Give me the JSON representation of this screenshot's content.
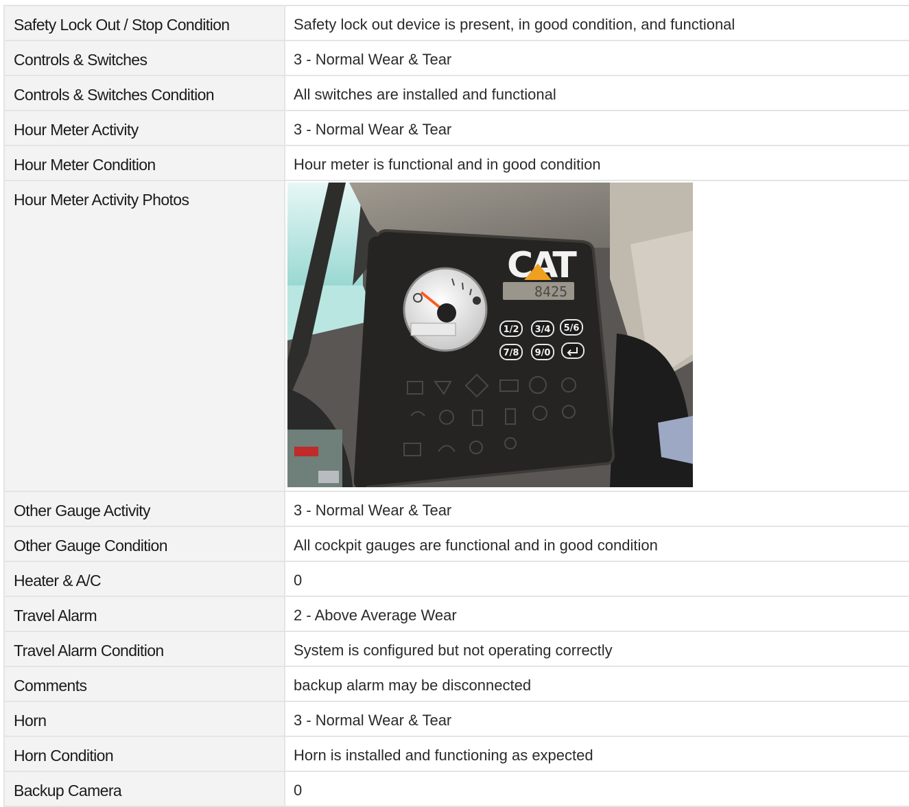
{
  "rows": [
    {
      "label": "Safety Lock Out / Stop Condition",
      "value": "Safety lock out device is present, in good condition, and functional"
    },
    {
      "label": "Controls & Switches",
      "value": "3 - Normal Wear & Tear"
    },
    {
      "label": "Controls & Switches Condition",
      "value": "All switches are installed and functional"
    },
    {
      "label": "Hour Meter Activity",
      "value": "3 - Normal Wear & Tear"
    },
    {
      "label": "Hour Meter Condition",
      "value": "Hour meter is functional and in good condition"
    }
  ],
  "photo_row": {
    "label": "Hour Meter Activity Photos",
    "photo": {
      "brand_text": "CAT",
      "hour_reading": "8425",
      "keypad_keys": [
        "1/2",
        "3/4",
        "5/6",
        "7/8",
        "9/0",
        "enter"
      ],
      "colors": {
        "panel": "#252422",
        "brand_triangle": "#f0a020",
        "gauge_needle": "#ff5a1e",
        "lcd": "#9a968c"
      }
    }
  },
  "rows2": [
    {
      "label": "Other Gauge Activity",
      "value": "3 - Normal Wear & Tear"
    },
    {
      "label": "Other Gauge Condition",
      "value": "All cockpit gauges are functional and in good condition"
    },
    {
      "label": "Heater & A/C",
      "value": "0"
    },
    {
      "label": "Travel Alarm",
      "value": "2 - Above Average Wear"
    },
    {
      "label": "Travel Alarm Condition",
      "value": "System is configured but not operating correctly"
    },
    {
      "label": "Comments",
      "value": "backup alarm may be disconnected"
    },
    {
      "label": "Horn",
      "value": "3 - Normal Wear & Tear"
    },
    {
      "label": "Horn Condition",
      "value": "Horn is installed and functioning as expected"
    },
    {
      "label": "Backup Camera",
      "value": "0"
    }
  ]
}
